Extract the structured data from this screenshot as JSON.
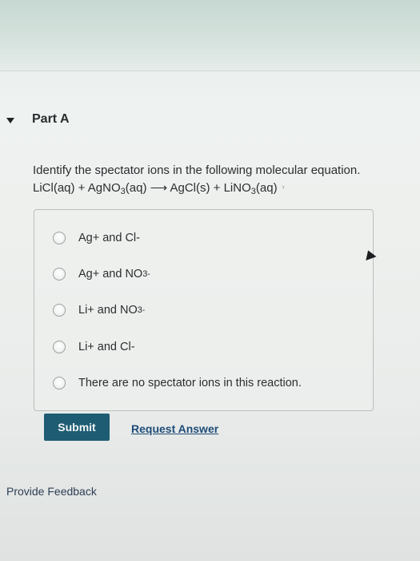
{
  "part": {
    "title": "Part A"
  },
  "question": {
    "prompt": "Identify the spectator ions in the following molecular equation.",
    "equation": {
      "lhs1": "LiCl(aq) + AgNO",
      "sub1": "3",
      "lhs2": "(aq)",
      "arrow": "⟶",
      "rhs1": "AgCl(s) + LiNO",
      "sub2": "3",
      "rhs2": "(aq)"
    }
  },
  "options": [
    {
      "text": "Ag+ and Cl-"
    },
    {
      "text": "Ag+ and NO",
      "sub": "3",
      "sup": "-"
    },
    {
      "text": "Li+ and NO",
      "sub": "3",
      "sup": "-"
    },
    {
      "text": "Li+ and Cl-"
    },
    {
      "text": "There are no spectator ions in this reaction."
    }
  ],
  "actions": {
    "submit_label": "Submit",
    "request_answer_label": "Request Answer"
  },
  "footer": {
    "feedback_label": "Provide Feedback"
  },
  "colors": {
    "submit_bg": "#1e5c73",
    "link": "#1f4c78"
  },
  "icons": {
    "collapse": "caret-down-icon",
    "pointer": "mouse-cursor-icon"
  }
}
